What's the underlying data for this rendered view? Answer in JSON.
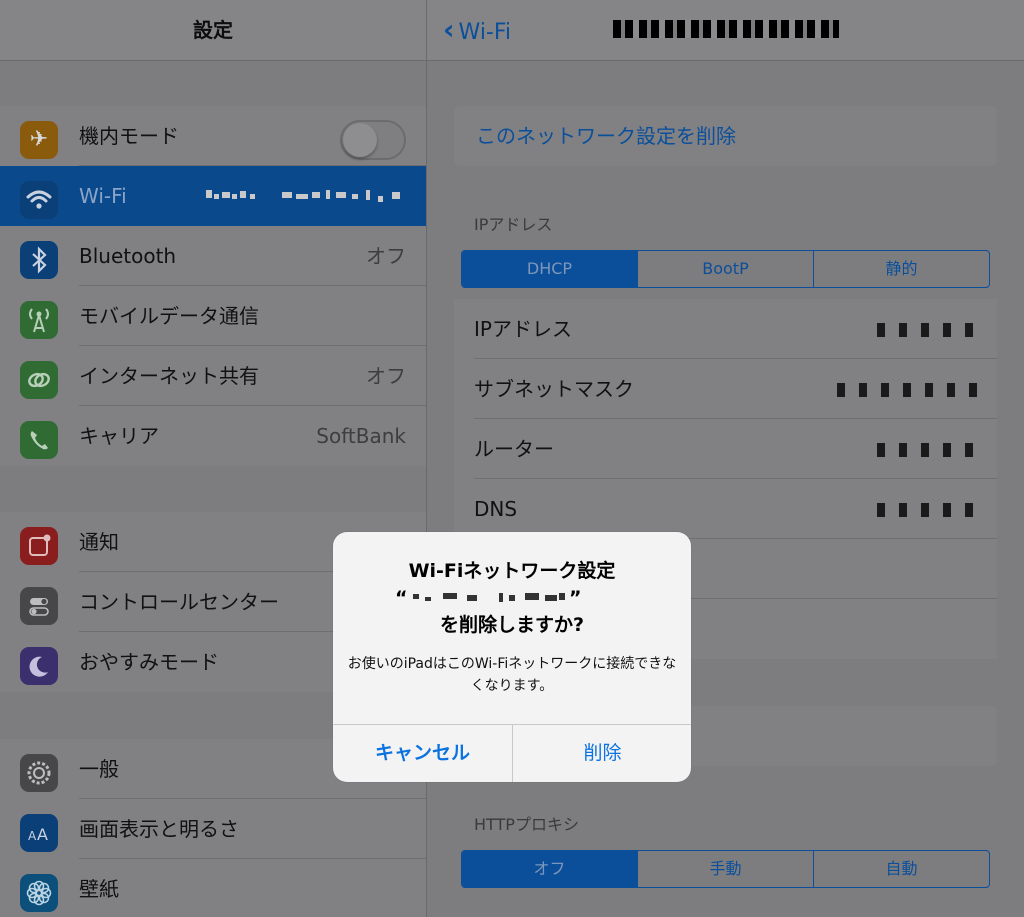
{
  "sidebar": {
    "title": "設定",
    "groups": [
      [
        {
          "label": "機内モード",
          "icon": "airplane-icon",
          "color": "#8a5a0d",
          "control": "toggle"
        },
        {
          "label": "Wi-Fi",
          "icon": "wifi-icon",
          "color": "#0b3f78",
          "value": "",
          "selected": true
        },
        {
          "label": "Bluetooth",
          "icon": "bluetooth-icon",
          "color": "#0b3f78",
          "value": "オフ"
        },
        {
          "label": "モバイルデータ通信",
          "icon": "antenna-icon",
          "color": "#2f6b33",
          "value": ""
        },
        {
          "label": "インターネット共有",
          "icon": "link-icon",
          "color": "#2f6b33",
          "value": "オフ"
        },
        {
          "label": "キャリア",
          "icon": "phone-icon",
          "color": "#2f6b33",
          "value": "SoftBank"
        }
      ],
      [
        {
          "label": "通知",
          "icon": "notification-icon",
          "color": "#8a1d1d",
          "value": ""
        },
        {
          "label": "コントロールセンター",
          "icon": "control-center-icon",
          "color": "#474749",
          "value": ""
        },
        {
          "label": "おやすみモード",
          "icon": "moon-icon",
          "color": "#3b2f6e",
          "value": ""
        }
      ],
      [
        {
          "label": "一般",
          "icon": "gear-icon",
          "color": "#474749",
          "value": ""
        },
        {
          "label": "画面表示と明るさ",
          "icon": "text-size-icon",
          "color": "#0b3f78",
          "value": ""
        },
        {
          "label": "壁紙",
          "icon": "flower-icon",
          "color": "#0b4f7a",
          "value": ""
        }
      ]
    ]
  },
  "detail": {
    "back_label": "Wi-Fi",
    "forget_label": "このネットワーク設定を削除",
    "ip_section_label": "IPアドレス",
    "ip_segments": [
      {
        "label": "DHCP",
        "active": true
      },
      {
        "label": "BootP",
        "active": false
      },
      {
        "label": "静的",
        "active": false
      }
    ],
    "ip_rows": [
      "IPアドレス",
      "サブネットマスク",
      "ルーター",
      "DNS"
    ],
    "http_proxy_label": "HTTPプロキシ",
    "proxy_segments": [
      {
        "label": "オフ",
        "active": true
      },
      {
        "label": "手動",
        "active": false
      },
      {
        "label": "自動",
        "active": false
      }
    ]
  },
  "alert": {
    "title_line1": "Wi-Fiネットワーク設定",
    "title_line2_open": "“",
    "title_line2_close": "”",
    "title_line3": "を削除しますか?",
    "message": "お使いのiPadはこのWi-Fiネットワークに接続できなくなります。",
    "cancel_label": "キャンセル",
    "delete_label": "削除"
  }
}
